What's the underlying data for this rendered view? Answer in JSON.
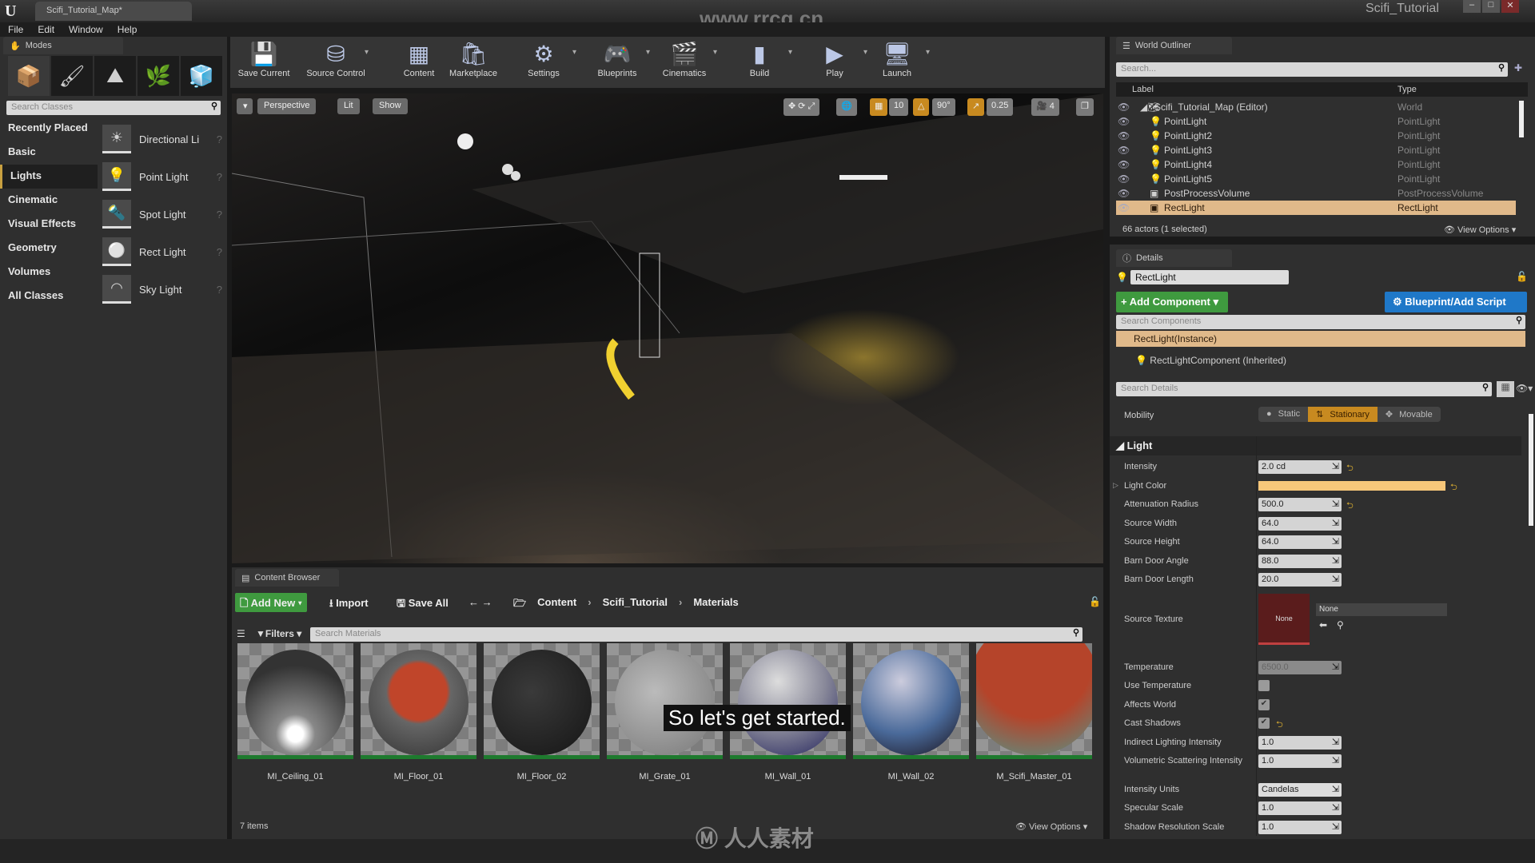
{
  "window": {
    "tab": "Scifi_Tutorial_Map*",
    "project": "Scifi_Tutorial",
    "watermark_url": "www.rrcg.cn",
    "watermark_logo": "人人素材"
  },
  "menu": [
    "File",
    "Edit",
    "Window",
    "Help"
  ],
  "modes": {
    "tab": "Modes",
    "search_placeholder": "Search Classes",
    "mode_icons": [
      "place-icon",
      "paint-icon",
      "landscape-icon",
      "foliage-icon",
      "geometry-edit-icon"
    ],
    "categories": [
      "Recently Placed",
      "Basic",
      "Lights",
      "Cinematic",
      "Visual Effects",
      "Geometry",
      "Volumes",
      "All Classes"
    ],
    "selected_category": "Lights",
    "items": [
      "Directional Li",
      "Point Light",
      "Spot Light",
      "Rect Light",
      "Sky Light"
    ]
  },
  "toolbar": [
    {
      "label": "Save Current",
      "icon": "💾",
      "dropdown": false
    },
    {
      "label": "Source Control",
      "icon": "⛁",
      "dropdown": true
    },
    {
      "label": "Content",
      "icon": "▦",
      "dropdown": false
    },
    {
      "label": "Marketplace",
      "icon": "🛍",
      "dropdown": false
    },
    {
      "label": "Settings",
      "icon": "⚙",
      "dropdown": true
    },
    {
      "label": "Blueprints",
      "icon": "🎮",
      "dropdown": true
    },
    {
      "label": "Cinematics",
      "icon": "🎬",
      "dropdown": true
    },
    {
      "label": "Build",
      "icon": "▮",
      "dropdown": true
    },
    {
      "label": "Play",
      "icon": "▶",
      "dropdown": true
    },
    {
      "label": "Launch",
      "icon": "🖥",
      "dropdown": true
    }
  ],
  "viewport": {
    "perspective": "Perspective",
    "lit": "Lit",
    "show": "Show",
    "grid_snap": "10",
    "rotation_snap": "90°",
    "scale_snap": "0.25",
    "camera_speed": "4"
  },
  "content_browser": {
    "tab": "Content Browser",
    "add_new": "Add New",
    "import": "Import",
    "save_all": "Save All",
    "breadcrumb": [
      "Content",
      "Scifi_Tutorial",
      "Materials"
    ],
    "filters": "Filters",
    "search_placeholder": "Search Materials",
    "assets": [
      "MI_Ceiling_01",
      "MI_Floor_01",
      "MI_Floor_02",
      "MI_Grate_01",
      "MI_Wall_01",
      "MI_Wall_02",
      "M_Scifi_Master_01"
    ],
    "item_count": "7 items",
    "view_options": "View Options"
  },
  "subtitle": "So let's get started.",
  "outliner": {
    "tab": "World Outliner",
    "search_placeholder": "Search...",
    "col_label": "Label",
    "col_type": "Type",
    "rows": [
      {
        "label": "Scifi_Tutorial_Map (Editor)",
        "type": "World"
      },
      {
        "label": "PointLight",
        "type": "PointLight"
      },
      {
        "label": "PointLight2",
        "type": "PointLight"
      },
      {
        "label": "PointLight3",
        "type": "PointLight"
      },
      {
        "label": "PointLight4",
        "type": "PointLight"
      },
      {
        "label": "PointLight5",
        "type": "PointLight"
      },
      {
        "label": "PostProcessVolume",
        "type": "PostProcessVolume"
      },
      {
        "label": "RectLight",
        "type": "RectLight"
      }
    ],
    "selected": "RectLight",
    "status": "66 actors (1 selected)",
    "view_options": "View Options"
  },
  "details": {
    "tab": "Details",
    "name": "RectLight",
    "add_component": "+ Add Component",
    "blueprint": "Blueprint/Add Script",
    "search_components": "Search Components",
    "instance": "RectLight(Instance)",
    "component": "RectLightComponent (Inherited)",
    "search_details": "Search Details",
    "mobility_label": "Mobility",
    "mobility": [
      "Static",
      "Stationary",
      "Movable"
    ],
    "mobility_selected": "Stationary",
    "section": "Light",
    "light_color": "#f7c77a",
    "props": [
      {
        "label": "Intensity",
        "value": "2.0 cd",
        "reset": true
      },
      {
        "label": "Light Color",
        "color": true,
        "reset": true
      },
      {
        "label": "Attenuation Radius",
        "value": "500.0",
        "reset": true
      },
      {
        "label": "Source Width",
        "value": "64.0"
      },
      {
        "label": "Source Height",
        "value": "64.0"
      },
      {
        "label": "Barn Door Angle",
        "value": "88.0"
      },
      {
        "label": "Barn Door Length",
        "value": "20.0"
      }
    ],
    "source_texture": {
      "label": "Source Texture",
      "thumb": "None",
      "value": "None"
    },
    "props2": [
      {
        "label": "Temperature",
        "value": "6500.0",
        "disabled": true
      },
      {
        "label": "Use Temperature",
        "check": false
      },
      {
        "label": "Affects World",
        "check": true
      },
      {
        "label": "Cast Shadows",
        "check": true,
        "reset": true
      },
      {
        "label": "Indirect Lighting Intensity",
        "value": "1.0"
      },
      {
        "label": "Volumetric Scattering Intensity",
        "value": "1.0"
      }
    ],
    "props3": [
      {
        "label": "Intensity Units",
        "value": "Candelas",
        "dropdown": true
      },
      {
        "label": "Specular Scale",
        "value": "1.0"
      },
      {
        "label": "Shadow Resolution Scale",
        "value": "1.0"
      }
    ]
  },
  "colors": {
    "accent_orange": "#c88a20",
    "selection": "#e0b98a",
    "green_button": "#3f9a3f",
    "blue_button": "#1f78c8"
  }
}
